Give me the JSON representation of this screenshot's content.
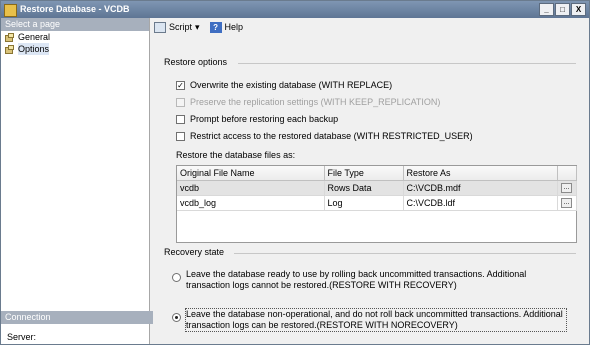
{
  "window": {
    "title": "Restore Database - VCDB",
    "controls": [
      "_",
      "□",
      "X"
    ]
  },
  "left_pane": {
    "select_page_header": "Select a page",
    "pages": [
      {
        "label": "General",
        "selected": false
      },
      {
        "label": "Options",
        "selected": true
      }
    ],
    "connection_header": "Connection",
    "server_label": "Server:"
  },
  "toolbar": {
    "script_label": "Script",
    "help_label": "Help"
  },
  "restore_options": {
    "group_title": "Restore options",
    "options": [
      {
        "label": "Overwrite the existing database (WITH REPLACE)",
        "checked": true,
        "enabled": true
      },
      {
        "label": "Preserve the replication settings (WITH KEEP_REPLICATION)",
        "checked": false,
        "enabled": false
      },
      {
        "label": "Prompt before restoring each backup",
        "checked": false,
        "enabled": true
      },
      {
        "label": "Restrict access to the restored database (WITH RESTRICTED_USER)",
        "checked": false,
        "enabled": true
      }
    ],
    "files_label": "Restore the database files as:",
    "columns": [
      "Original File Name",
      "File Type",
      "Restore As"
    ],
    "rows": [
      {
        "original": "vcdb",
        "type": "Rows Data",
        "restore_as": "C:\\VCDB.mdf",
        "selected": true
      },
      {
        "original": "vcdb_log",
        "type": "Log",
        "restore_as": "C:\\VCDB.ldf",
        "selected": false
      }
    ],
    "browse_label": "..."
  },
  "recovery_state": {
    "group_title": "Recovery state",
    "options": [
      {
        "label": "Leave the database ready to use by rolling back uncommitted transactions. Additional transaction logs cannot be restored.(RESTORE WITH RECOVERY)",
        "selected": false
      },
      {
        "label": "Leave the database non-operational, and do not roll back uncommitted transactions. Additional transaction logs can be restored.(RESTORE WITH NORECOVERY)",
        "selected": true
      }
    ]
  }
}
